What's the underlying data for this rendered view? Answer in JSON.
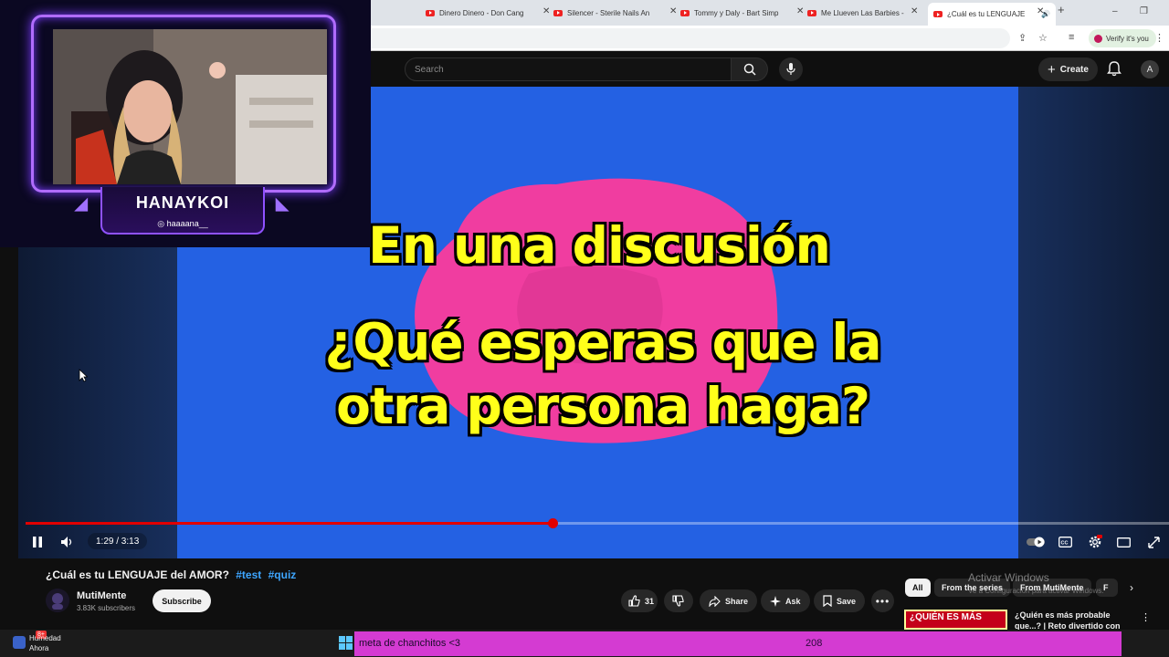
{
  "browser": {
    "tabs": [
      {
        "title": "Dinero Dinero - Don Cang",
        "active": false
      },
      {
        "title": "Silencer - Sterile Nails An",
        "active": false
      },
      {
        "title": "Tommy y Daly - Bart Simp",
        "active": false
      },
      {
        "title": "Me Llueven Las Barbies -",
        "active": false
      },
      {
        "title": "¿Cuál es tu LENGUAJE",
        "active": true
      }
    ],
    "new_tab": "+",
    "verify_label": "Verify it's you"
  },
  "youtube": {
    "search_placeholder": "Search",
    "create_label": "Create",
    "avatar_letter": "A"
  },
  "video": {
    "caption_line1": "En una discusión",
    "caption_line2": "¿Qué esperas que la",
    "caption_line3": "otra persona haga?",
    "time_display": "1:29 / 3:13",
    "progress_fraction": 0.461,
    "title": "¿Cuál es tu LENGUAJE del AMOR?",
    "hashtags": [
      "#test",
      "#quiz"
    ],
    "channel_name": "MutiMente",
    "subscribers": "3.83K subscribers",
    "subscribe_label": "Subscribe",
    "like_count": "31",
    "share_label": "Share",
    "ask_label": "Ask",
    "save_label": "Save"
  },
  "sidebar": {
    "chips": [
      "All",
      "From the series",
      "From MutiMente",
      "F"
    ],
    "rec_thumb_text": "¿QUIÉN ES MÁS",
    "rec_title": "¿Quién es más probable que...? | Reto divertido con"
  },
  "windows_watermark": {
    "title": "Activar Windows",
    "subtitle": "Ve a Configuración para activar Windows."
  },
  "stream_overlay": {
    "streamer_name": "HANAYKOI",
    "handle": "haaaana__"
  },
  "taskbar": {
    "weather_title": "Humedad",
    "weather_sub": "Ahora",
    "weather_badge": "8+",
    "goal_label": "meta de chanchitos <3",
    "goal_count": "208"
  },
  "colors": {
    "video_bg": "#2461e3",
    "caption_yellow": "#ffff1a",
    "progress_red": "#e10000",
    "overlay_purple": "#b06cff",
    "goal_bar": "#d43bd2"
  }
}
